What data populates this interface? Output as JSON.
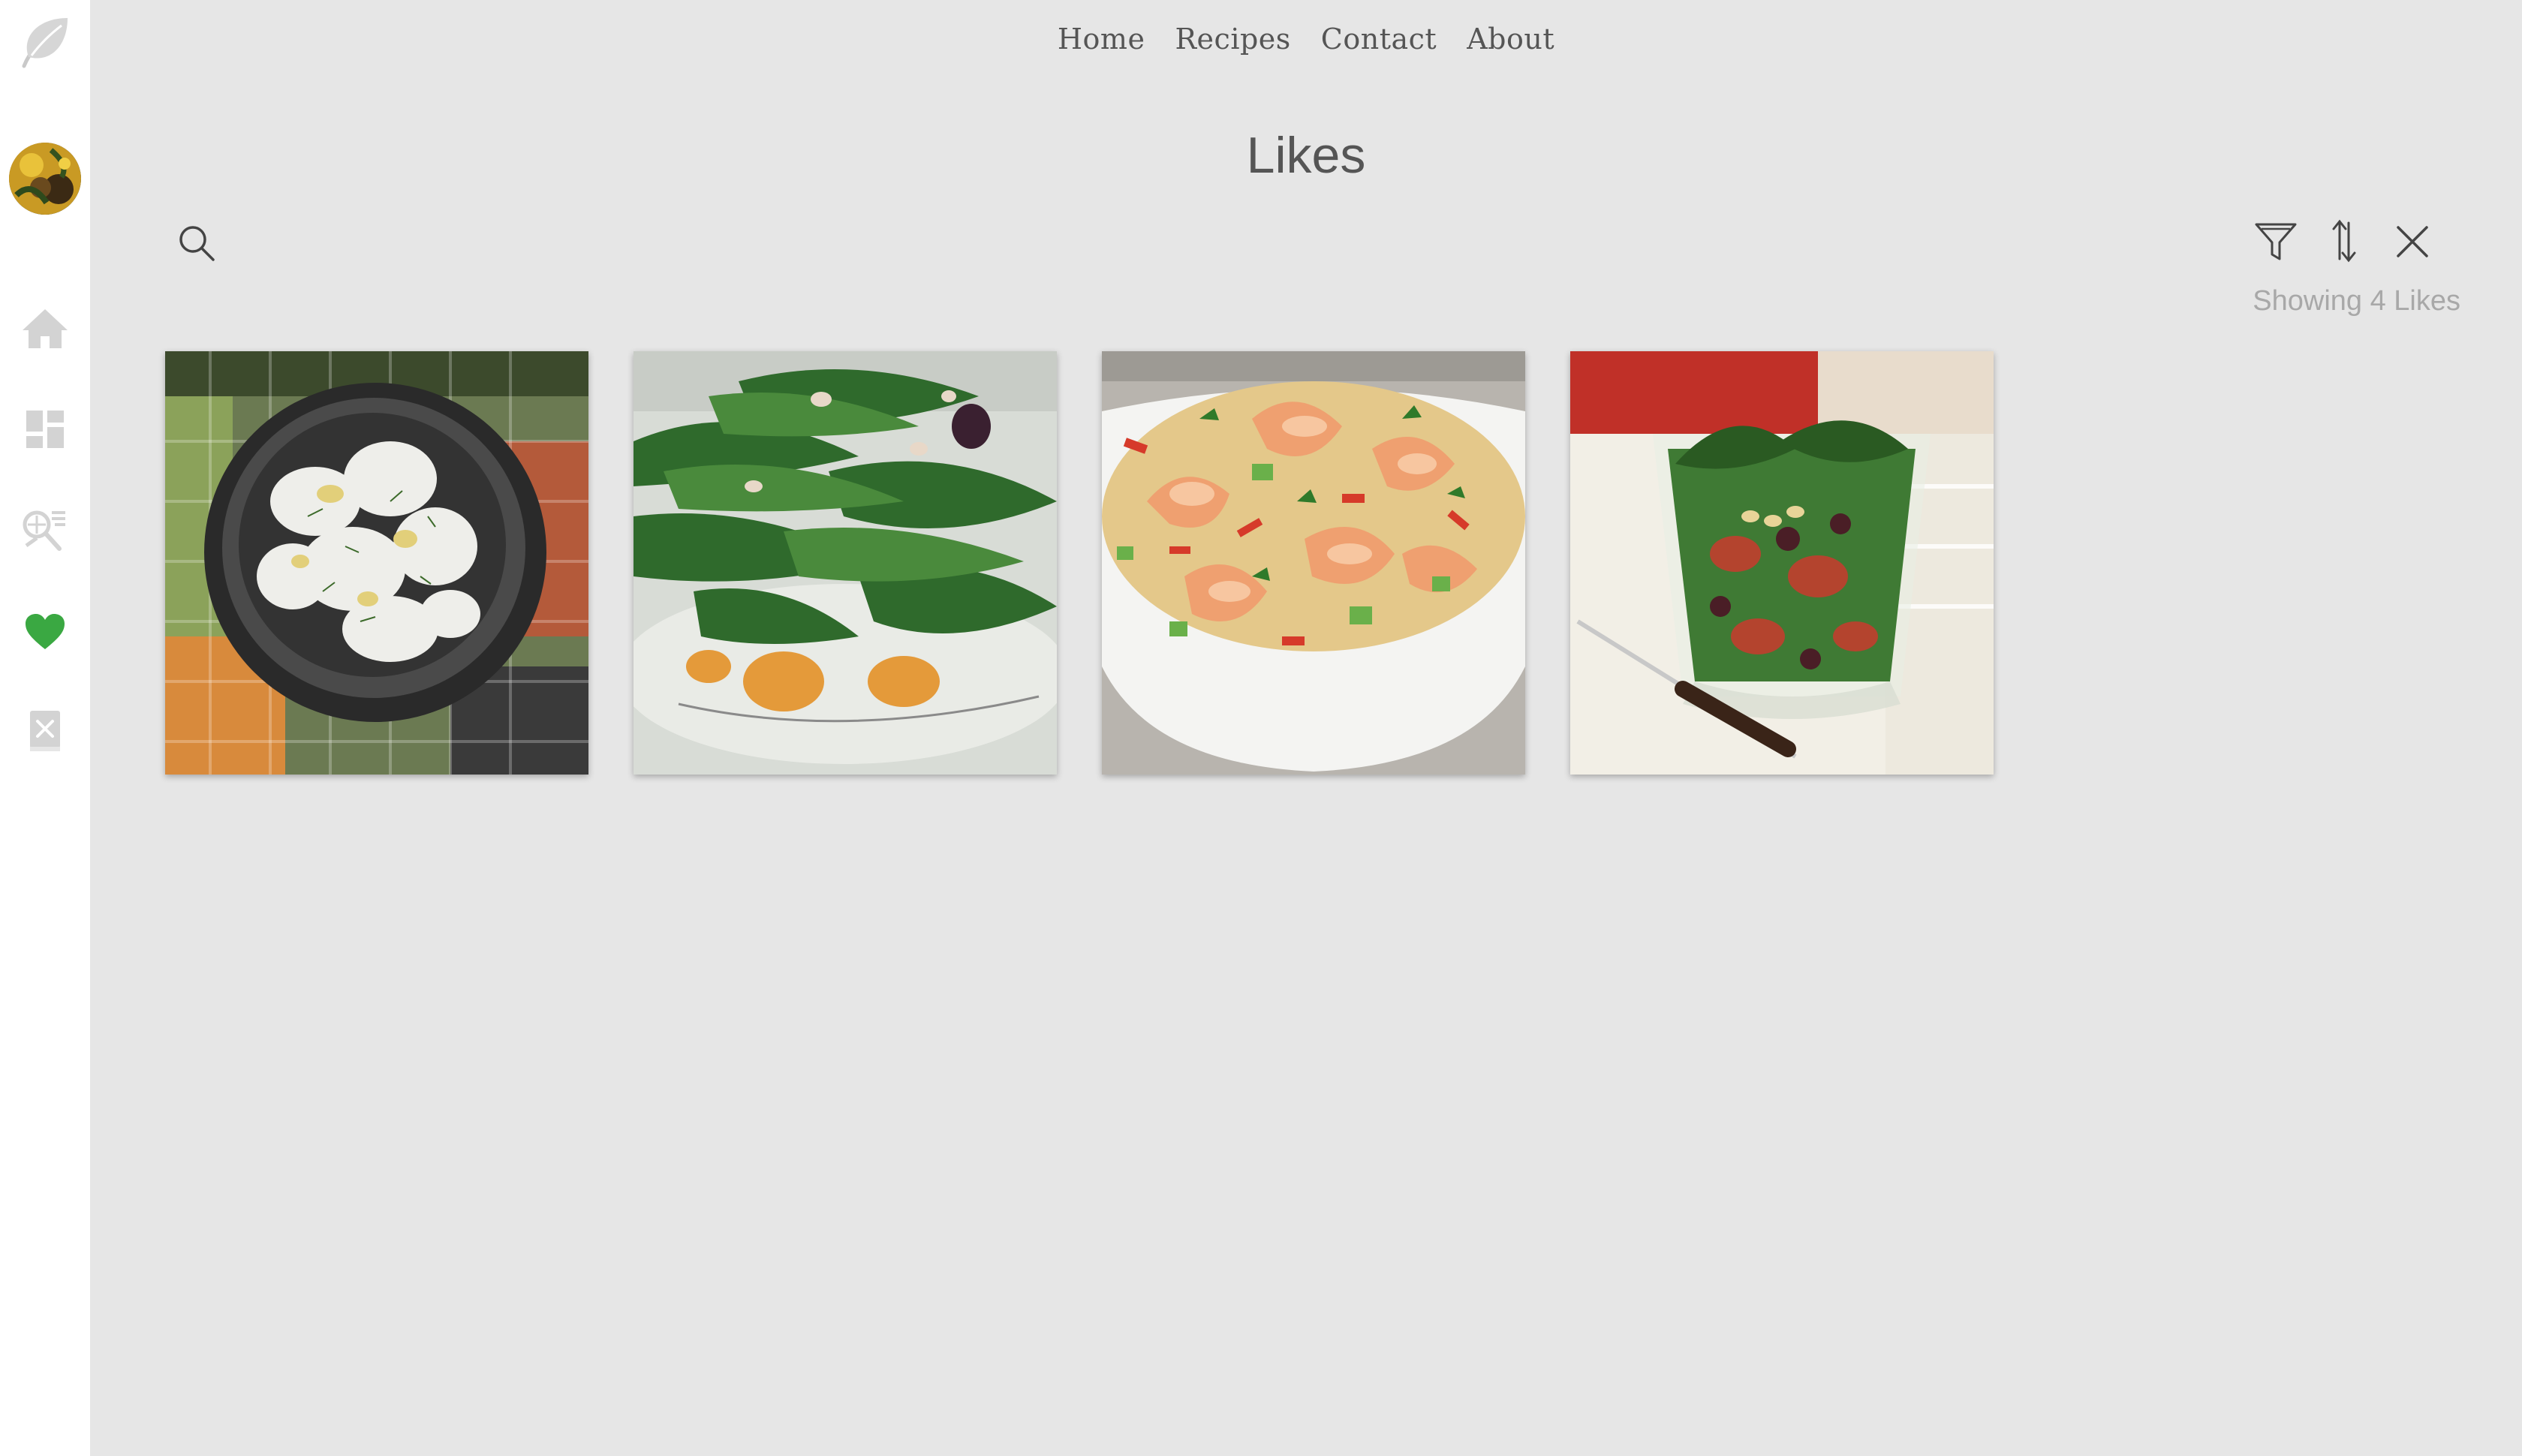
{
  "nav": {
    "items": [
      {
        "label": "Home"
      },
      {
        "label": "Recipes"
      },
      {
        "label": "Contact"
      },
      {
        "label": "About"
      }
    ]
  },
  "page": {
    "title": "Likes",
    "showing_text": "Showing 4 Likes"
  },
  "sidebar": {
    "icons": [
      "leaf-logo-icon",
      "avatar",
      "home-icon",
      "dashboard-icon",
      "recipe-search-icon",
      "heart-icon",
      "recipe-book-icon"
    ],
    "active_color": "#3aa842",
    "inactive_color": "#d3d3d3"
  },
  "toolbar": {
    "icons": [
      "search-icon",
      "filter-icon",
      "sort-icon",
      "close-icon"
    ]
  },
  "likes": [
    {
      "image": "potato-salad-bowl"
    },
    {
      "image": "arugula-salad"
    },
    {
      "image": "shrimp-quinoa-bowl"
    },
    {
      "image": "layered-salad-glass"
    }
  ]
}
